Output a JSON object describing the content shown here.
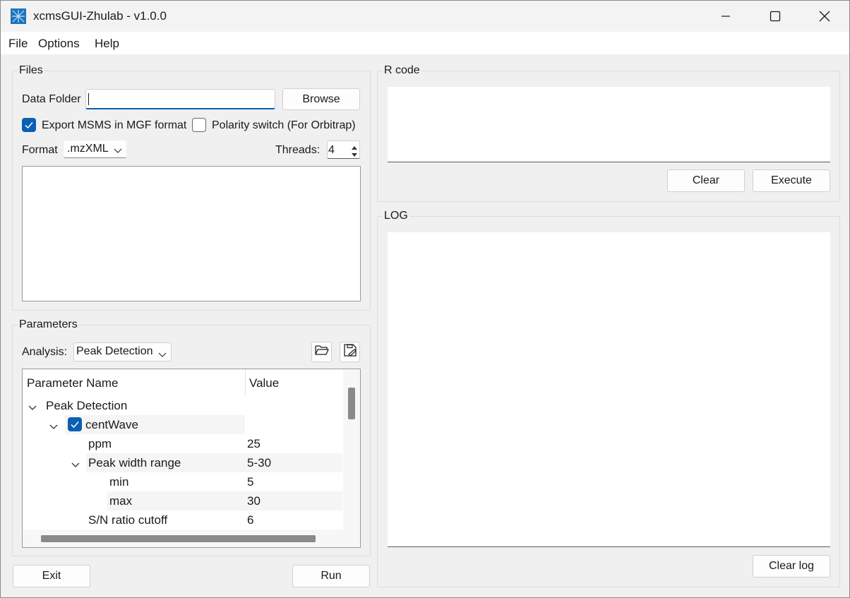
{
  "window": {
    "title": "xcmsGUI-Zhulab - v1.0.0",
    "icons": [
      "app-icon",
      "minimize-icon",
      "maximize-icon",
      "close-icon"
    ]
  },
  "menu": {
    "file": "File",
    "options": "Options",
    "help": "Help"
  },
  "files": {
    "group_title": "Files",
    "data_folder_label": "Data Folder",
    "data_folder_value": "",
    "browse_label": "Browse",
    "export_msms_label": "Export MSMS in MGF format",
    "export_msms_checked": true,
    "polarity_label": "Polarity switch (For Orbitrap)",
    "polarity_checked": false,
    "format_label": "Format",
    "format_value": ".mzXML",
    "threads_label": "Threads:",
    "threads_value": "4"
  },
  "parameters": {
    "group_title": "Parameters",
    "analysis_label": "Analysis:",
    "analysis_value": "Peak Detection",
    "icons": [
      "open-folder-icon",
      "save-icon"
    ],
    "columns": [
      "Parameter Name",
      "Value"
    ],
    "rows": [
      {
        "name": "Peak Detection",
        "value": ""
      },
      {
        "name": "centWave",
        "value": "",
        "checked": true
      },
      {
        "name": "ppm",
        "value": "25"
      },
      {
        "name": "Peak width range",
        "value": "5-30"
      },
      {
        "name": "min",
        "value": "5"
      },
      {
        "name": "max",
        "value": "30"
      },
      {
        "name": "S/N ratio cutoff",
        "value": "6"
      }
    ]
  },
  "rcode": {
    "group_title": "R code",
    "clear_label": "Clear",
    "execute_label": "Execute"
  },
  "log": {
    "group_title": "LOG",
    "clear_log_label": "Clear log"
  },
  "bottom": {
    "exit_label": "Exit",
    "run_label": "Run"
  },
  "colors": {
    "accent": "#0a5fb4",
    "background": "#f0f0f0"
  }
}
